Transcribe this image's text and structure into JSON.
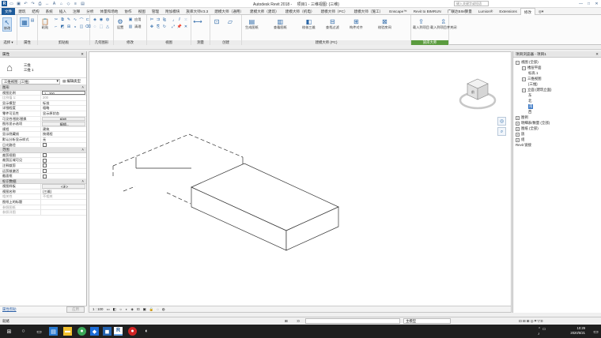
{
  "titlebar": {
    "app": "Autodesk Revit 2018 -",
    "doc": "项目1 - 三维视图: {三维}",
    "search_placeholder": "键入关键字或短语",
    "qa_icons": [
      "folder-open-icon",
      "save-icon",
      "undo-icon",
      "redo-icon",
      "print-icon",
      "measure-icon",
      "text-icon",
      "3d-view-icon",
      "section-icon",
      "thin-lines-icon",
      "close-hidden-icon",
      "switch-windows-icon"
    ]
  },
  "tabs": [
    "文件",
    "建筑",
    "结构",
    "系统",
    "插入",
    "注释",
    "分析",
    "体量和场地",
    "协作",
    "视图",
    "管理",
    "附加模块",
    "族库大师V3.3",
    "建模大师（通用）",
    "建模大师（建筑）",
    "建模大师（机电）",
    "建模大师（PC）",
    "建模大师（施工）",
    "Enscape™",
    "Revit to BIMRUN",
    "广联达BIM算量",
    "Lumion®",
    "Extensions",
    "修改",
    "◎▾"
  ],
  "active_tab": "修改",
  "ribbon": {
    "groups": [
      {
        "label": "选择 ▾"
      },
      {
        "label": "属性"
      },
      {
        "label": "剪贴板"
      },
      {
        "label": "几何图形"
      },
      {
        "label": "修改"
      },
      {
        "label": "视图"
      },
      {
        "label": "测量"
      },
      {
        "label": "创建"
      },
      {
        "label": "建模大师 (PC)"
      },
      {
        "label": "族库大师"
      }
    ],
    "items": {
      "modify": "修改",
      "paste": "粘贴",
      "settings": "设置",
      "apply": "应用",
      "clean": "清理",
      "join": "连接",
      "checkpoint": "检查",
      "generate_wall": "生成图纸",
      "intelligent_category": "查看图纸",
      "check_3d": "校核三维",
      "tidy_filter": "查找过滤",
      "quick_align": "构件对齐",
      "check_collision": "校验房间",
      "load_family": "载入到项目",
      "load_and_close": "载入到项目并关闭"
    }
  },
  "properties": {
    "title": "属性",
    "family": "三维",
    "type": "三维 1",
    "view_dropdown": "三维视图: {三维}",
    "edit_type": "编辑类型",
    "section_graphics": "图形",
    "section_range": "范围",
    "section_identity": "标识数据",
    "rows_graphics": [
      {
        "k": "视图比例",
        "v": "1 : 200",
        "style": "inp"
      },
      {
        "k": "比例值 1:",
        "v": "200",
        "style": "dim"
      },
      {
        "k": "显示模型",
        "v": "标准"
      },
      {
        "k": "详细程度",
        "v": "粗略"
      },
      {
        "k": "零件可见性",
        "v": "显示原状态"
      },
      {
        "k": "可见性/图形替换",
        "v": "编辑...",
        "style": "btn"
      },
      {
        "k": "图形显示选项",
        "v": "编辑...",
        "style": "btn"
      },
      {
        "k": "规程",
        "v": "建筑"
      },
      {
        "k": "显示隐藏线",
        "v": "按规程"
      },
      {
        "k": "默认分析显示样式",
        "v": "无"
      },
      {
        "k": "日光路径",
        "v": "",
        "style": "cb"
      }
    ],
    "rows_range": [
      {
        "k": "裁剪视图",
        "v": "",
        "style": "cb"
      },
      {
        "k": "裁剪区域可见",
        "v": "",
        "style": "cb"
      },
      {
        "k": "注释裁剪",
        "v": "",
        "style": "cb"
      },
      {
        "k": "远剪裁激活",
        "v": "",
        "style": "cb"
      },
      {
        "k": "截面框",
        "v": "",
        "style": "cb"
      }
    ],
    "rows_identity": [
      {
        "k": "视图样板",
        "v": "<无>",
        "style": "btn"
      },
      {
        "k": "视图名称",
        "v": "{三维}"
      },
      {
        "k": "相关性",
        "v": "不相关",
        "style": "dim"
      },
      {
        "k": "图纸上的标题",
        "v": ""
      },
      {
        "k": "参照图纸",
        "v": "",
        "style": "dim"
      },
      {
        "k": "参照详图",
        "v": "",
        "style": "dim"
      }
    ],
    "help_link": "属性帮助",
    "apply_button": "应用"
  },
  "browser": {
    "title": "项目浏览器 - 项目1",
    "tree": [
      {
        "label": "视图 (全部)",
        "level": 0,
        "toggle": "−"
      },
      {
        "label": "楼层平面",
        "level": 1,
        "toggle": "−"
      },
      {
        "label": "标高 1",
        "level": 2,
        "toggle": ""
      },
      {
        "label": "三维视图",
        "level": 1,
        "toggle": "−"
      },
      {
        "label": "{三维}",
        "level": 2,
        "toggle": ""
      },
      {
        "label": "立面 (建筑立面)",
        "level": 1,
        "toggle": "−"
      },
      {
        "label": "东",
        "level": 2,
        "toggle": ""
      },
      {
        "label": "北",
        "level": 2,
        "toggle": ""
      },
      {
        "label": "南",
        "level": 2,
        "toggle": "",
        "selected": true
      },
      {
        "label": "西",
        "level": 2,
        "toggle": ""
      },
      {
        "label": "图例",
        "level": 0,
        "toggle": "+"
      },
      {
        "label": "明细表/数量 (全部)",
        "level": 0,
        "toggle": "+"
      },
      {
        "label": "图纸 (全部)",
        "level": 0,
        "toggle": "+"
      },
      {
        "label": "族",
        "level": 0,
        "toggle": "+"
      },
      {
        "label": "组",
        "level": 0,
        "toggle": "+"
      },
      {
        "label": "Revit 链接",
        "level": 0,
        "toggle": ""
      }
    ]
  },
  "viewcube": {
    "face": "前"
  },
  "viewcontrol": {
    "scale": "1 : 100"
  },
  "status": {
    "left": "就绪",
    "model": ":0",
    "filter": "主模型"
  },
  "taskbar": {
    "time": "10:29",
    "date": "2020/5/21"
  }
}
